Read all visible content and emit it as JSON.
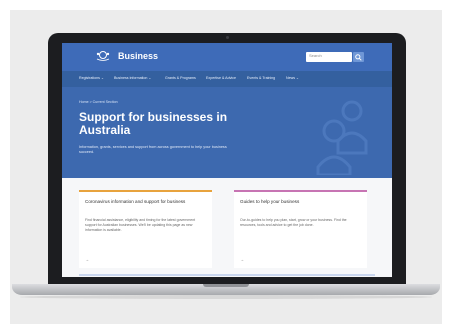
{
  "site": {
    "brand": "Business",
    "search_placeholder": "Search"
  },
  "nav": {
    "items": [
      {
        "label": "Registrations ⌄"
      },
      {
        "label": "Business information ⌄"
      },
      {
        "label": "Grants & Programs"
      },
      {
        "label": "Expertise & Advice"
      },
      {
        "label": "Events & Training"
      },
      {
        "label": "News ⌄"
      }
    ]
  },
  "hero": {
    "breadcrumb": "Home > Current Section",
    "title": "Support for businesses in Australia",
    "description": "Information, grants, services and support from across government to help your business succeed."
  },
  "cards": [
    {
      "title": "Coronavirus information and support for business",
      "text": "Find financial assistance, eligibility and timing for the latest government support for Australian businesses. We'll be updating this page as new information is available.",
      "arrow": "→",
      "accent": "#e8a33d"
    },
    {
      "title": "Guides to help your business",
      "text": "Our-to-guides to help you plan, start, grow or your business. Find the resources, tools and advice to get the job done.",
      "arrow": "→",
      "accent": "#c774b3"
    }
  ],
  "colors": {
    "header": "#3e6bb8",
    "nav": "#34609f",
    "hero": "#3d69af"
  },
  "icons": {
    "crest": "coat-of-arms-icon",
    "search": "search-icon",
    "hero_graphic": "people-icon"
  }
}
